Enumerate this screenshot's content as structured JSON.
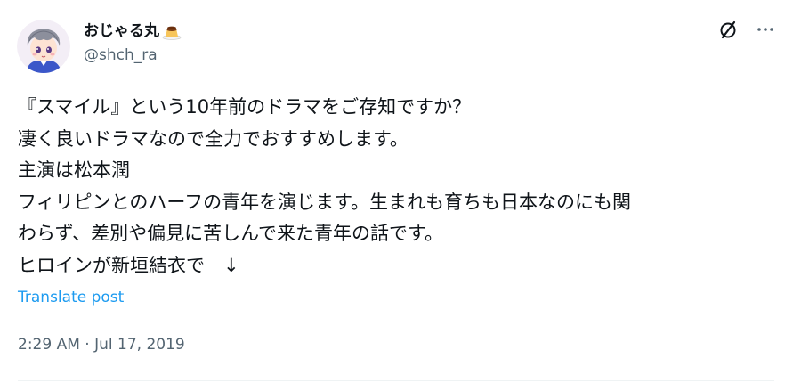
{
  "user": {
    "display_name": "おじゃる丸",
    "name_emoji": "pudding-icon",
    "handle": "@shch_ra",
    "avatar": "avatar-character-illustration"
  },
  "actions": {
    "grok_icon": "grok-slash-icon",
    "more_icon": "more-icon"
  },
  "post": {
    "lines": [
      "『スマイル』という10年前のドラマをご存知ですか？",
      "凄く良いドラマなので全力でおすすめします。",
      "主演は松本潤",
      "フィリピンとのハーフの青年を演じます。生まれも育ちも日本なのにも関",
      "わらず、差別や偏見に苦しんで来た青年の話です。",
      "ヒロインが新垣結衣で　↓"
    ],
    "translate_label": "Translate post",
    "timestamp": "2:29 AM · Jul 17, 2019"
  },
  "colors": {
    "text_primary": "#0f1419",
    "text_secondary": "#536471",
    "link": "#1d9bf0"
  }
}
